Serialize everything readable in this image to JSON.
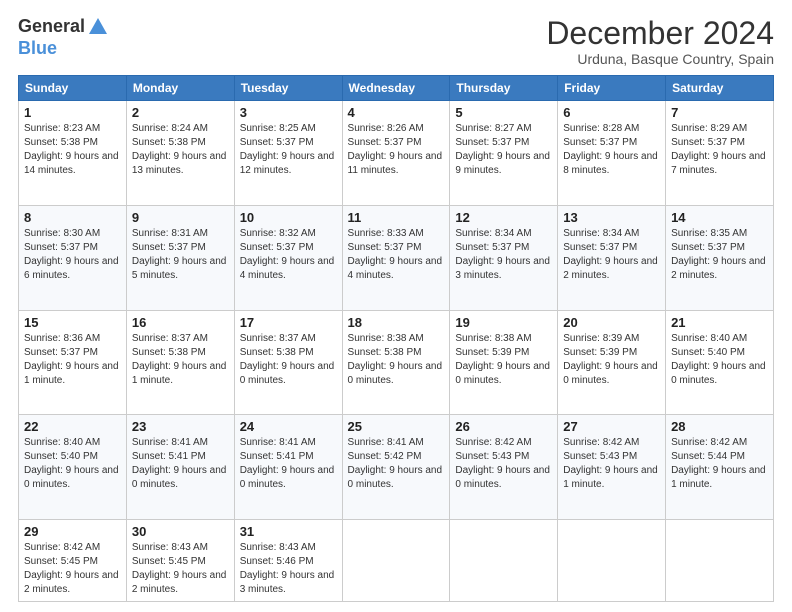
{
  "header": {
    "logo_line1": "General",
    "logo_line2": "Blue",
    "month_title": "December 2024",
    "location": "Urduna, Basque Country, Spain"
  },
  "weekdays": [
    "Sunday",
    "Monday",
    "Tuesday",
    "Wednesday",
    "Thursday",
    "Friday",
    "Saturday"
  ],
  "weeks": [
    [
      {
        "day": "1",
        "sunrise": "8:23 AM",
        "sunset": "5:38 PM",
        "daylight": "9 hours and 14 minutes."
      },
      {
        "day": "2",
        "sunrise": "8:24 AM",
        "sunset": "5:38 PM",
        "daylight": "9 hours and 13 minutes."
      },
      {
        "day": "3",
        "sunrise": "8:25 AM",
        "sunset": "5:37 PM",
        "daylight": "9 hours and 12 minutes."
      },
      {
        "day": "4",
        "sunrise": "8:26 AM",
        "sunset": "5:37 PM",
        "daylight": "9 hours and 11 minutes."
      },
      {
        "day": "5",
        "sunrise": "8:27 AM",
        "sunset": "5:37 PM",
        "daylight": "9 hours and 9 minutes."
      },
      {
        "day": "6",
        "sunrise": "8:28 AM",
        "sunset": "5:37 PM",
        "daylight": "9 hours and 8 minutes."
      },
      {
        "day": "7",
        "sunrise": "8:29 AM",
        "sunset": "5:37 PM",
        "daylight": "9 hours and 7 minutes."
      }
    ],
    [
      {
        "day": "8",
        "sunrise": "8:30 AM",
        "sunset": "5:37 PM",
        "daylight": "9 hours and 6 minutes."
      },
      {
        "day": "9",
        "sunrise": "8:31 AM",
        "sunset": "5:37 PM",
        "daylight": "9 hours and 5 minutes."
      },
      {
        "day": "10",
        "sunrise": "8:32 AM",
        "sunset": "5:37 PM",
        "daylight": "9 hours and 4 minutes."
      },
      {
        "day": "11",
        "sunrise": "8:33 AM",
        "sunset": "5:37 PM",
        "daylight": "9 hours and 4 minutes."
      },
      {
        "day": "12",
        "sunrise": "8:34 AM",
        "sunset": "5:37 PM",
        "daylight": "9 hours and 3 minutes."
      },
      {
        "day": "13",
        "sunrise": "8:34 AM",
        "sunset": "5:37 PM",
        "daylight": "9 hours and 2 minutes."
      },
      {
        "day": "14",
        "sunrise": "8:35 AM",
        "sunset": "5:37 PM",
        "daylight": "9 hours and 2 minutes."
      }
    ],
    [
      {
        "day": "15",
        "sunrise": "8:36 AM",
        "sunset": "5:37 PM",
        "daylight": "9 hours and 1 minute."
      },
      {
        "day": "16",
        "sunrise": "8:37 AM",
        "sunset": "5:38 PM",
        "daylight": "9 hours and 1 minute."
      },
      {
        "day": "17",
        "sunrise": "8:37 AM",
        "sunset": "5:38 PM",
        "daylight": "9 hours and 0 minutes."
      },
      {
        "day": "18",
        "sunrise": "8:38 AM",
        "sunset": "5:38 PM",
        "daylight": "9 hours and 0 minutes."
      },
      {
        "day": "19",
        "sunrise": "8:38 AM",
        "sunset": "5:39 PM",
        "daylight": "9 hours and 0 minutes."
      },
      {
        "day": "20",
        "sunrise": "8:39 AM",
        "sunset": "5:39 PM",
        "daylight": "9 hours and 0 minutes."
      },
      {
        "day": "21",
        "sunrise": "8:40 AM",
        "sunset": "5:40 PM",
        "daylight": "9 hours and 0 minutes."
      }
    ],
    [
      {
        "day": "22",
        "sunrise": "8:40 AM",
        "sunset": "5:40 PM",
        "daylight": "9 hours and 0 minutes."
      },
      {
        "day": "23",
        "sunrise": "8:41 AM",
        "sunset": "5:41 PM",
        "daylight": "9 hours and 0 minutes."
      },
      {
        "day": "24",
        "sunrise": "8:41 AM",
        "sunset": "5:41 PM",
        "daylight": "9 hours and 0 minutes."
      },
      {
        "day": "25",
        "sunrise": "8:41 AM",
        "sunset": "5:42 PM",
        "daylight": "9 hours and 0 minutes."
      },
      {
        "day": "26",
        "sunrise": "8:42 AM",
        "sunset": "5:43 PM",
        "daylight": "9 hours and 0 minutes."
      },
      {
        "day": "27",
        "sunrise": "8:42 AM",
        "sunset": "5:43 PM",
        "daylight": "9 hours and 1 minute."
      },
      {
        "day": "28",
        "sunrise": "8:42 AM",
        "sunset": "5:44 PM",
        "daylight": "9 hours and 1 minute."
      }
    ],
    [
      {
        "day": "29",
        "sunrise": "8:42 AM",
        "sunset": "5:45 PM",
        "daylight": "9 hours and 2 minutes."
      },
      {
        "day": "30",
        "sunrise": "8:43 AM",
        "sunset": "5:45 PM",
        "daylight": "9 hours and 2 minutes."
      },
      {
        "day": "31",
        "sunrise": "8:43 AM",
        "sunset": "5:46 PM",
        "daylight": "9 hours and 3 minutes."
      },
      null,
      null,
      null,
      null
    ]
  ],
  "labels": {
    "sunrise": "Sunrise:",
    "sunset": "Sunset:",
    "daylight": "Daylight:"
  }
}
